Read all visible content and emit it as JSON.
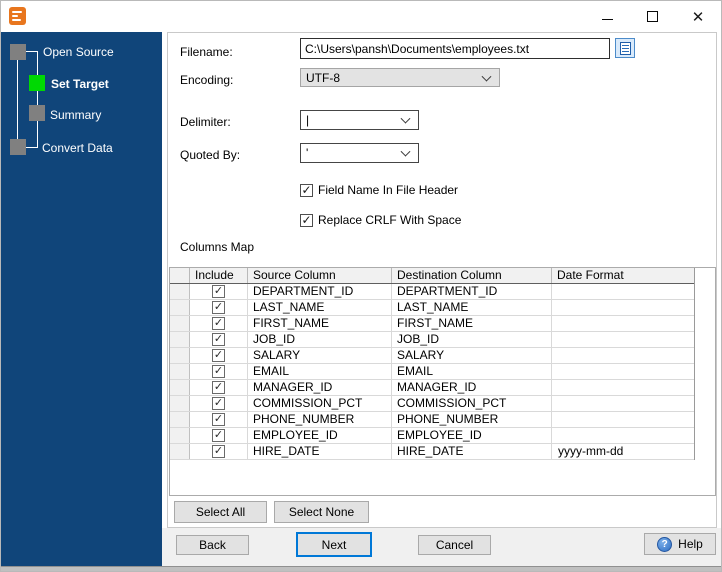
{
  "titlebar": {
    "close_glyph": "✕"
  },
  "icons": {
    "check_glyph": "✓",
    "help_glyph": "?"
  },
  "colors": {
    "sidebar_bg": "#10457a",
    "active_step": "#00d903",
    "pending_step": "#808080",
    "accent": "#0078d7",
    "app_icon": "#e8761e"
  },
  "sidebar": {
    "steps": [
      {
        "label": "Open Source",
        "state": "done"
      },
      {
        "label": "Set Target",
        "state": "active"
      },
      {
        "label": "Summary",
        "state": "pending"
      },
      {
        "label": "Convert Data",
        "state": "pending"
      }
    ]
  },
  "form": {
    "filename": {
      "label": "Filename:",
      "value": "C:\\Users\\pansh\\Documents\\employees.txt"
    },
    "encoding": {
      "label": "Encoding:",
      "value": "UTF-8"
    },
    "delimiter": {
      "label": "Delimiter:",
      "value": "|"
    },
    "quoted_by": {
      "label": "Quoted By:",
      "value": "'"
    },
    "checkboxes": [
      {
        "label": "Field Name In File Header",
        "checked": true
      },
      {
        "label": "Replace CRLF With Space",
        "checked": true
      }
    ]
  },
  "columns_map": {
    "section_label": "Columns Map",
    "headers": [
      "",
      "Include",
      "Source Column",
      "Destination Column",
      "Date Format"
    ],
    "rows": [
      {
        "include": true,
        "source": "DEPARTMENT_ID",
        "destination": "DEPARTMENT_ID",
        "date_format": ""
      },
      {
        "include": true,
        "source": "LAST_NAME",
        "destination": "LAST_NAME",
        "date_format": ""
      },
      {
        "include": true,
        "source": "FIRST_NAME",
        "destination": "FIRST_NAME",
        "date_format": ""
      },
      {
        "include": true,
        "source": "JOB_ID",
        "destination": "JOB_ID",
        "date_format": ""
      },
      {
        "include": true,
        "source": "SALARY",
        "destination": "SALARY",
        "date_format": ""
      },
      {
        "include": true,
        "source": "EMAIL",
        "destination": "EMAIL",
        "date_format": ""
      },
      {
        "include": true,
        "source": "MANAGER_ID",
        "destination": "MANAGER_ID",
        "date_format": ""
      },
      {
        "include": true,
        "source": "COMMISSION_PCT",
        "destination": "COMMISSION_PCT",
        "date_format": ""
      },
      {
        "include": true,
        "source": "PHONE_NUMBER",
        "destination": "PHONE_NUMBER",
        "date_format": ""
      },
      {
        "include": true,
        "source": "EMPLOYEE_ID",
        "destination": "EMPLOYEE_ID",
        "date_format": ""
      },
      {
        "include": true,
        "source": "HIRE_DATE",
        "destination": "HIRE_DATE",
        "date_format": "yyyy-mm-dd"
      }
    ],
    "select_all_label": "Select All",
    "select_none_label": "Select None"
  },
  "footer": {
    "back_label": "Back",
    "next_label": "Next",
    "cancel_label": "Cancel",
    "help_label": "Help"
  }
}
